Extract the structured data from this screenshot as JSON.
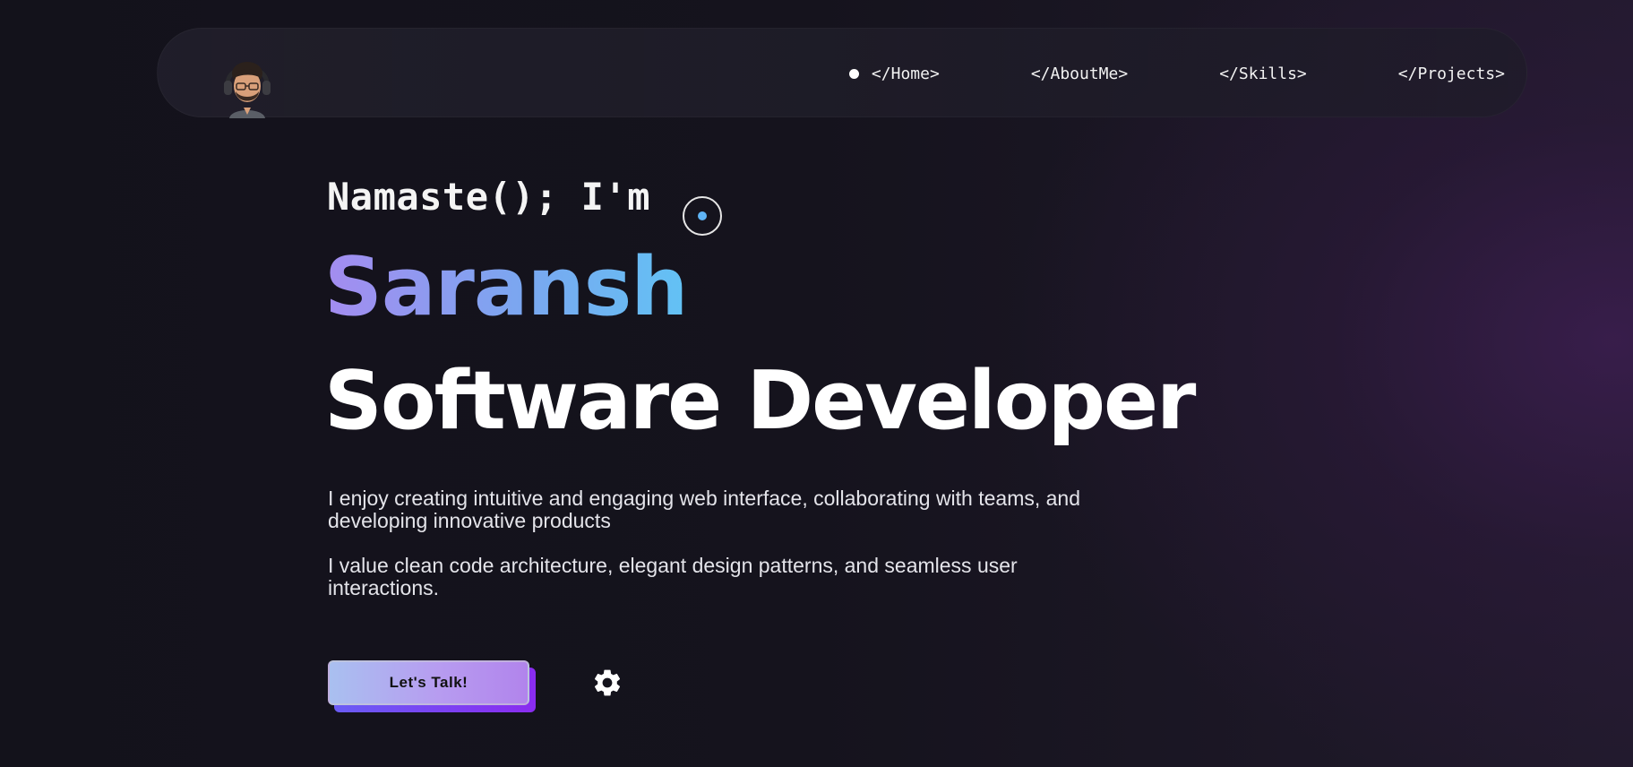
{
  "nav": {
    "items": [
      {
        "label": "Home",
        "active": true
      },
      {
        "label": "AboutMe",
        "active": false
      },
      {
        "label": "Skills",
        "active": false
      },
      {
        "label": "Projects",
        "active": false
      }
    ],
    "code_prefix": "</",
    "code_suffix": ">"
  },
  "hero": {
    "greeting": "Namaste(); I'm",
    "name": "Saransh",
    "role": "Software Developer",
    "paragraph1": "I enjoy creating intuitive and engaging web interface, collaborating with teams, and developing innovative products",
    "paragraph2": "I value clean code architecture, elegant design patterns, and seamless user interactions.",
    "cta_label": "Let's Talk!"
  },
  "icons": {
    "avatar": "avatar-with-headphones",
    "settings": "gear-icon",
    "cursor": "cursor-ring-icon"
  },
  "colors": {
    "background": "#14121c",
    "name_gradient_start": "#a48cf0",
    "name_gradient_end": "#62c2f4",
    "cta_start": "#a9c0f0",
    "cta_end": "#b184ec",
    "cta_shadow": "#8a2cf0"
  }
}
